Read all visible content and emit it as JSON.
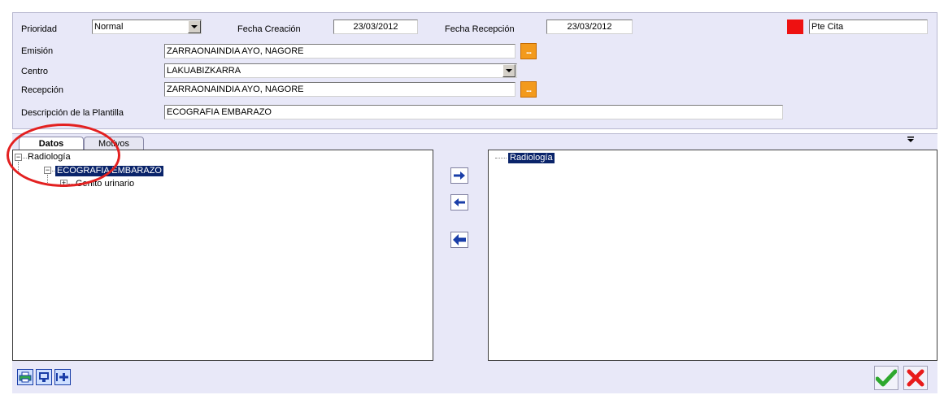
{
  "header": {
    "prioridad_label": "Prioridad",
    "prioridad_value": "Normal",
    "fecha_creacion_label": "Fecha Creación",
    "fecha_creacion_value": "23/03/2012",
    "fecha_recepcion_label": "Fecha Recepción",
    "fecha_recepcion_value": "23/03/2012",
    "status_color": "#ee1111",
    "status_value": "Pte Cita",
    "emision_label": "Emisión",
    "emision_value": "ZARRAONAINDIA AYO, NAGORE",
    "centro_label": "Centro",
    "centro_value": "LAKUABIZKARRA",
    "recepcion_label": "Recepción",
    "recepcion_value": "ZARRAONAINDIA AYO, NAGORE",
    "descripcion_label": "Descripción de la Plantilla",
    "descripcion_value": "ECOGRAFIA EMBARAZO",
    "dots_label": "..."
  },
  "tabs": [
    {
      "label": "Datos",
      "active": true
    },
    {
      "label": "Motivos",
      "active": false
    }
  ],
  "tab_menu_icon": "overflow-menu-icon",
  "left_tree": {
    "root": "Radiología",
    "child": "ECOGRAFIA EMBARAZO",
    "grandchild": "Genito urinario"
  },
  "right_tree": {
    "root": "Radiología"
  },
  "middle_buttons": [
    "move-right-icon",
    "move-left-icon",
    "move-all-left-icon"
  ],
  "bottom_toolbar": [
    "print-icon",
    "monitor-icon",
    "add-cross-icon"
  ],
  "actions": {
    "accept_icon": "checkmark-icon",
    "cancel_icon": "close-icon",
    "accept_color": "#2ea82e",
    "cancel_color": "#e81b1b"
  },
  "annotation_color": "#e32020"
}
